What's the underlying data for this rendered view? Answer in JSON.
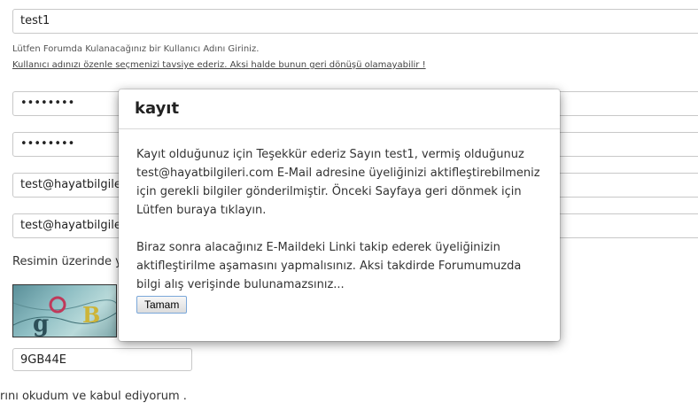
{
  "form": {
    "username_value": "test1",
    "username_hint": "Lütfen Forumda Kulanacağınız bir Kullanıcı Adını Giriniz.",
    "username_warning": "Kullanıcı adınızı özenle seçmenizi tavsiye ederiz. Aksi halde bunun geri dönüşü olamayabilir !",
    "password_value": "••••••••",
    "password_confirm_value": "••••••••",
    "email_value": "test@hayatbilgile",
    "email_confirm_value": "test@hayatbilgile",
    "captcha_prompt": "Resimin üzerinde y",
    "captcha_input_value": "9GB44E",
    "terms_text": "rını okudum ve kabul ediyorum ."
  },
  "modal": {
    "title": "kayıt",
    "paragraph1": "Kayıt olduğunuz için Teşekkür ederiz Sayın test1, vermiş olduğunuz test@hayatbilgileri.com E-Mail adresine üyeliğinizi aktifleştirebilmeniz için gerekli bilgiler gönderilmiştir. Önceki Sayfaya geri dönmek için Lütfen buraya tıklayın.",
    "paragraph2": "Biraz sonra alacağınız E-Maildeki Linki takip ederek üyeliğinizin aktifleştirilme aşamasını yapmalısınız. Aksi takdirde Forumumuzda bilgi alış verişinde bulunamazsınız...",
    "ok_label": "Tamam"
  }
}
